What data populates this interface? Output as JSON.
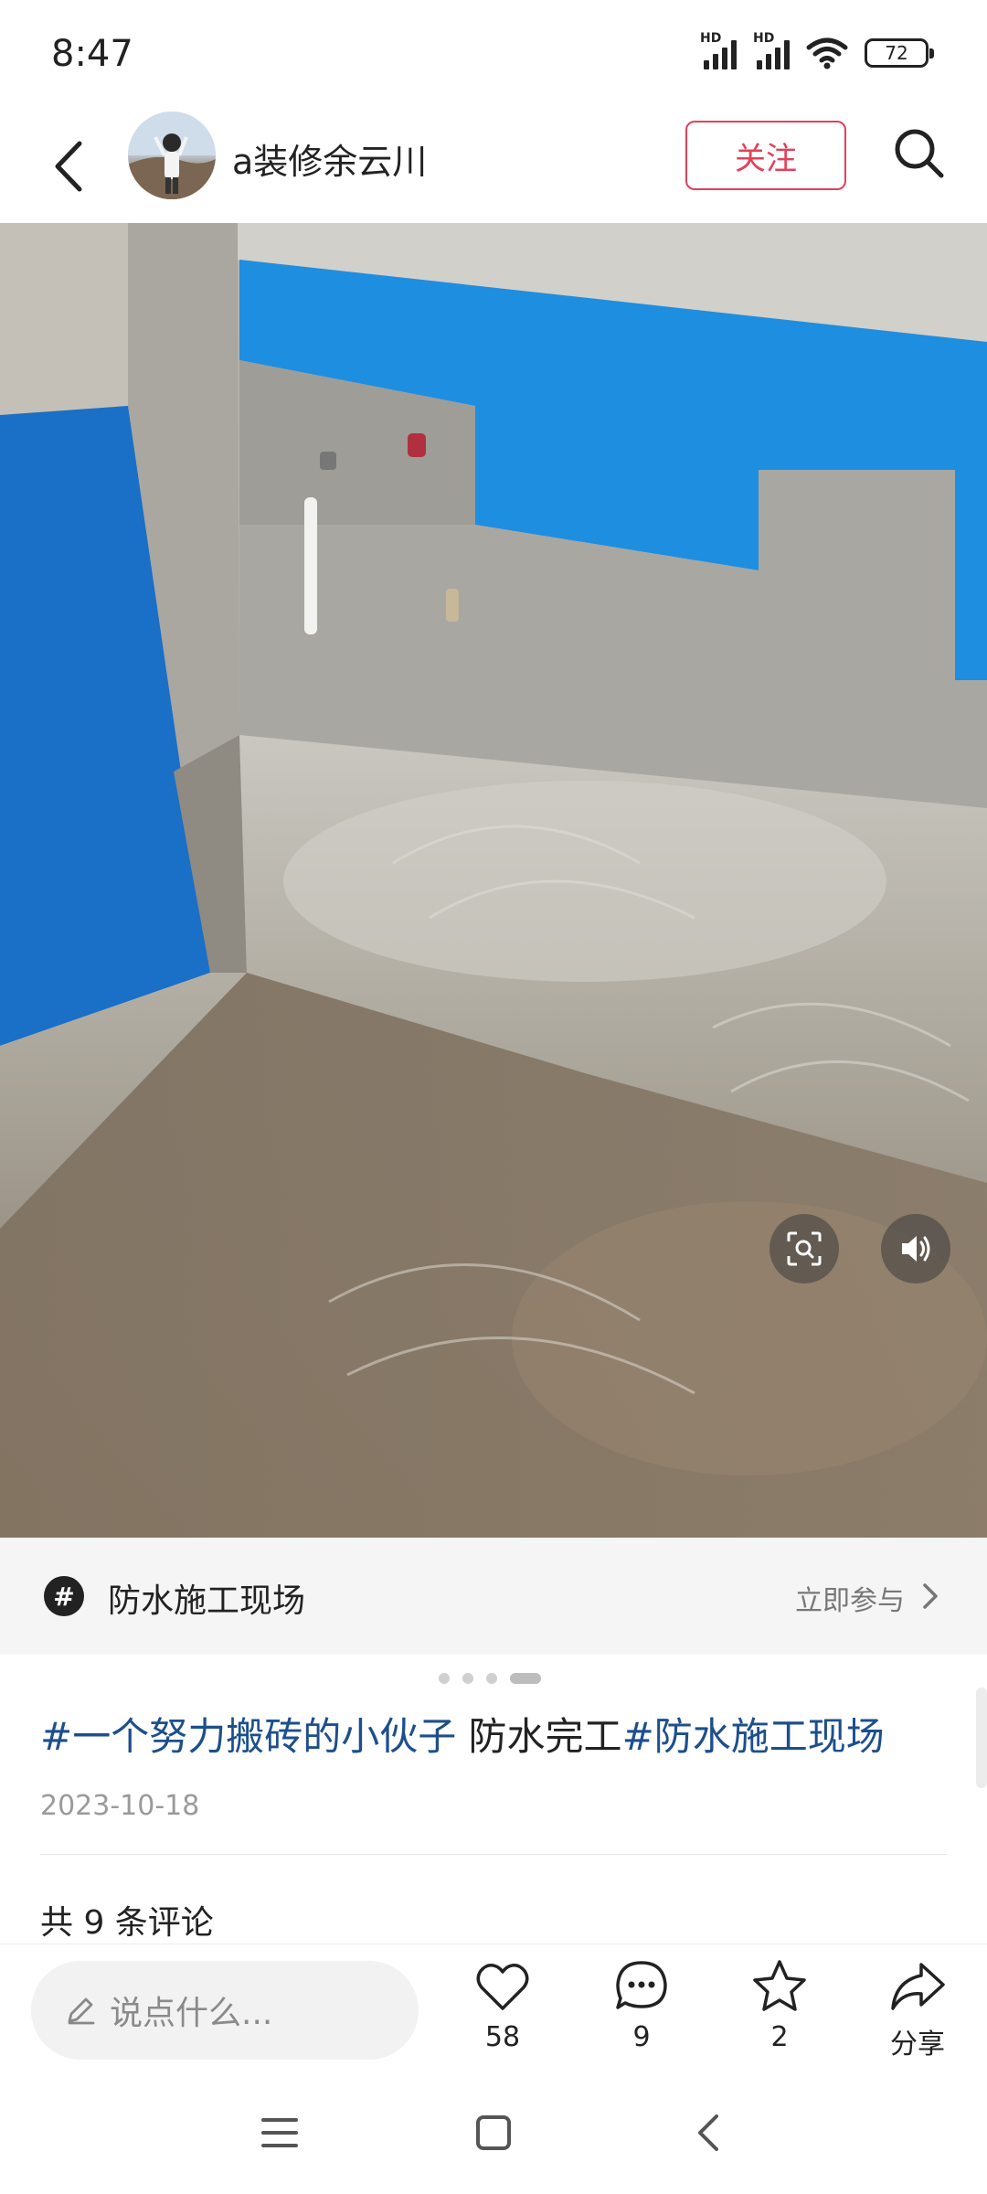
{
  "status_bar": {
    "time": "8:47",
    "signal_1_label": "HD",
    "signal_2_label": "HD",
    "battery": "72"
  },
  "header": {
    "username": "a装修余云川",
    "follow_label": "关注"
  },
  "topic": {
    "icon_glyph": "#",
    "name": "防水施工现场",
    "join_label": "立即参与"
  },
  "carousel": {
    "count": 4,
    "active": 4
  },
  "post": {
    "tag1": "#一个努力搬砖的小伙子",
    "text": " 防水完工",
    "tag2": "#防水施工现场",
    "date": "2023-10-18"
  },
  "comments": {
    "count_label": "共 9 条评论"
  },
  "actions": {
    "input_placeholder": "说点什么...",
    "likes": "58",
    "comments": "9",
    "favorites": "2",
    "share_label": "分享"
  },
  "colors": {
    "accent": "#e3405a",
    "tag": "#1d4f8c",
    "waterproof_blue": "#1e8ee0"
  },
  "icons": {
    "back": "back-arrow-icon",
    "search": "search-icon",
    "scan": "image-scan-icon",
    "volume": "volume-icon",
    "like": "heart-icon",
    "comment": "comment-bubble-icon",
    "favorite": "star-icon",
    "share": "share-arrow-icon",
    "pen": "pen-icon"
  }
}
